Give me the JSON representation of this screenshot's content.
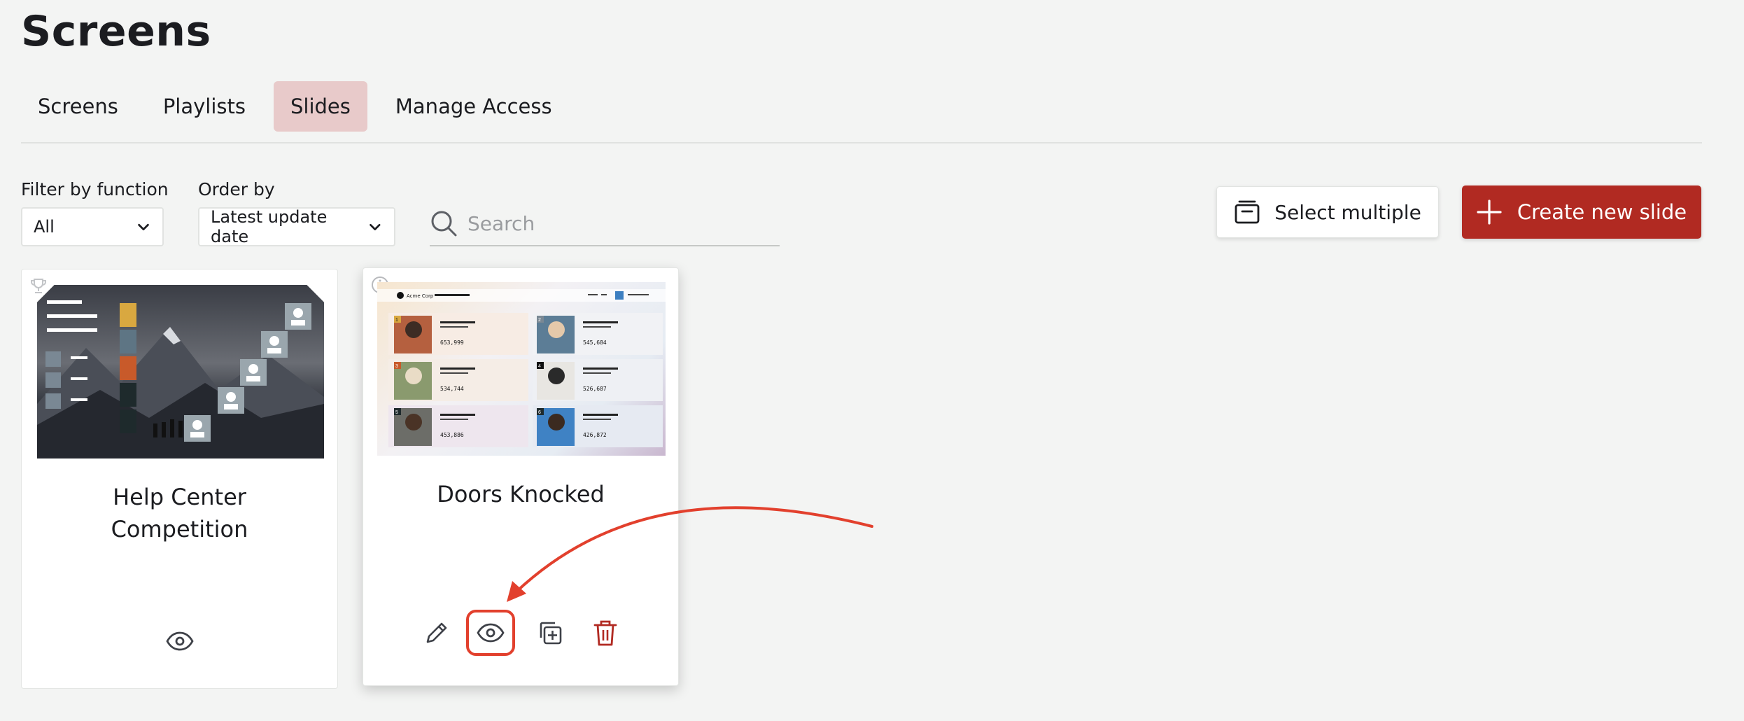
{
  "page": {
    "title": "Screens"
  },
  "tabs": [
    {
      "label": "Screens",
      "active": false
    },
    {
      "label": "Playlists",
      "active": false
    },
    {
      "label": "Slides",
      "active": true
    },
    {
      "label": "Manage Access",
      "active": false
    }
  ],
  "filters": {
    "function_label": "Filter by function",
    "function_value": "All",
    "order_label": "Order by",
    "order_value": "Latest update date",
    "search_placeholder": "Search"
  },
  "toolbar": {
    "select_multiple_label": "Select multiple",
    "create_label": "Create new slide"
  },
  "slides": [
    {
      "title_line1": "Help Center",
      "title_line2": "Competition",
      "icon": "trophy-icon"
    },
    {
      "title": "Doors Knocked",
      "icon": "info-icon",
      "preview": {
        "brand": "Acme Corp",
        "entries": [
          {
            "rank": "1",
            "value": "653,999"
          },
          {
            "rank": "2",
            "value": "545,684"
          },
          {
            "rank": "3",
            "value": "534,744"
          },
          {
            "rank": "4",
            "value": "526,687"
          },
          {
            "rank": "5",
            "value": "453,886"
          },
          {
            "rank": "6",
            "value": "426,872"
          }
        ]
      }
    }
  ],
  "colors": {
    "accent": "#b12a22",
    "active_tab": "#e8caca",
    "highlight": "#e2402d"
  }
}
